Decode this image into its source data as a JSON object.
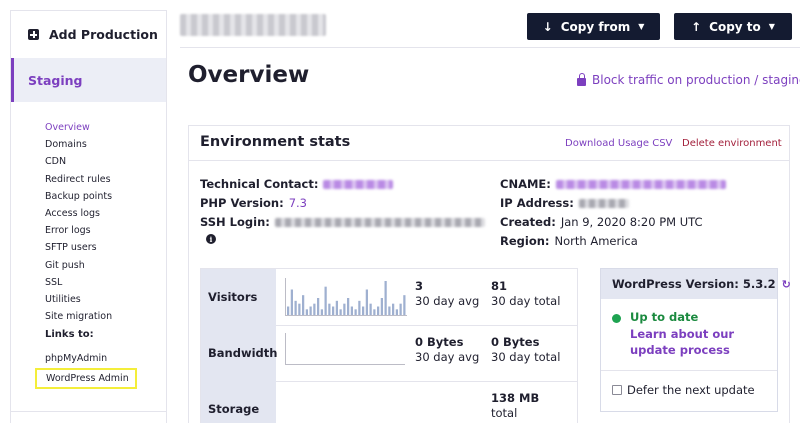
{
  "sidebar": {
    "add_production": "Add Production",
    "staging": "Staging",
    "nav_items": [
      "Overview",
      "Domains",
      "CDN",
      "Redirect rules",
      "Backup points",
      "Access logs",
      "Error logs",
      "SFTP users",
      "Git push",
      "SSL",
      "Utilities",
      "Site migration"
    ],
    "active_item": "Overview",
    "links_to_label": "Links to:",
    "links": [
      "phpMyAdmin",
      "WordPress Admin"
    ]
  },
  "header": {
    "copy_from": "Copy from",
    "copy_to": "Copy to",
    "page_title": "Overview",
    "block_traffic": "Block traffic on production / staging"
  },
  "env": {
    "title": "Environment stats",
    "download_csv": "Download Usage CSV",
    "delete_env": "Delete environment",
    "technical_contact_label": "Technical Contact:",
    "php_label": "PHP Version:",
    "php_value": "7.3",
    "ssh_label": "SSH Login:",
    "cname_label": "CNAME:",
    "ip_label": "IP Address:",
    "created_label": "Created:",
    "created_value": "Jan 9, 2020 8:20 PM UTC",
    "region_label": "Region:",
    "region_value": "North America"
  },
  "stats": {
    "rows": [
      {
        "label": "Visitors",
        "avg_value": "3",
        "avg_caption": "30 day avg",
        "total_value": "81",
        "total_caption": "30 day total"
      },
      {
        "label": "Bandwidth",
        "avg_value": "0 Bytes",
        "avg_caption": "30 day avg",
        "total_value": "0 Bytes",
        "total_caption": "30 day total"
      },
      {
        "label": "Storage",
        "total_value": "138 MB",
        "total_caption": "total"
      }
    ],
    "visitors_sparkline": [
      3,
      9,
      5,
      4,
      7,
      2,
      3,
      4,
      6,
      2,
      10,
      4,
      3,
      5,
      2,
      4,
      6,
      3,
      2,
      5,
      3,
      9,
      4,
      2,
      3,
      6,
      12,
      3,
      4,
      2,
      4,
      7
    ]
  },
  "wordpress": {
    "version_label": "WordPress Version: 5.3.2",
    "status": "Up to date",
    "learn_more": "Learn about our update process",
    "defer_label": "Defer the next update"
  }
}
